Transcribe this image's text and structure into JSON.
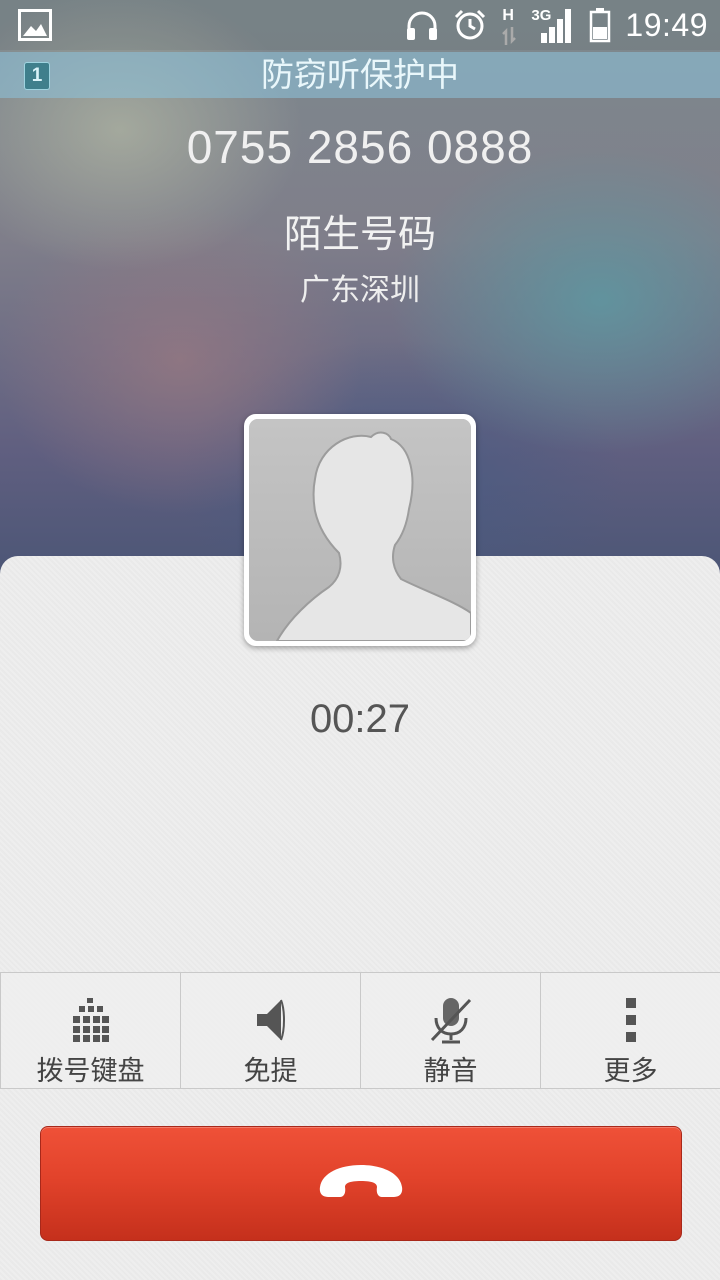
{
  "status_bar": {
    "time": "19:49",
    "network_label": "3G",
    "data_label": "H",
    "icons": [
      "gallery-icon",
      "headphones-icon",
      "alarm-icon",
      "data-activity-icon",
      "signal-icon",
      "battery-icon"
    ]
  },
  "security_bar": {
    "sim_slot": "1",
    "text": "防窃听保护中"
  },
  "caller": {
    "number": "0755 2856 0888",
    "label": "陌生号码",
    "location": "广东深圳"
  },
  "call": {
    "duration": "00:27"
  },
  "actions": [
    {
      "label": "拨号键盘",
      "icon": "dialpad-icon"
    },
    {
      "label": "免提",
      "icon": "speaker-icon"
    },
    {
      "label": "静音",
      "icon": "mute-mic-icon"
    },
    {
      "label": "更多",
      "icon": "more-icon"
    }
  ],
  "end_call": {
    "icon": "hangup-icon",
    "color": "#e2432b"
  }
}
